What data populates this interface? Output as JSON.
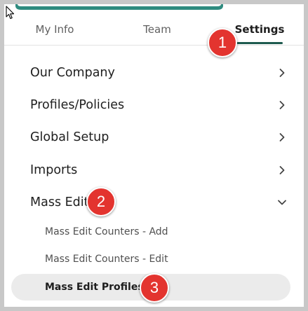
{
  "tabs": [
    {
      "label": "My Info",
      "active": false
    },
    {
      "label": "Team",
      "active": false
    },
    {
      "label": "Settings",
      "active": true
    }
  ],
  "menu": [
    {
      "label": "Our Company",
      "chevron": "chevron-right"
    },
    {
      "label": "Profiles/Policies",
      "chevron": "chevron-right"
    },
    {
      "label": "Global Setup",
      "chevron": "chevron-right"
    },
    {
      "label": "Imports",
      "chevron": "chevron-right"
    },
    {
      "label": "Mass Edit",
      "chevron": "chevron-down"
    }
  ],
  "submenu": [
    {
      "label": "Mass Edit Counters - Add",
      "selected": false
    },
    {
      "label": "Mass Edit Counters - Edit",
      "selected": false
    },
    {
      "label": "Mass Edit Profiles",
      "selected": true
    }
  ],
  "steps": [
    "1",
    "2",
    "3"
  ],
  "colors": {
    "accent": "#1e5a4f",
    "badge": "#e3342f",
    "selected_bg": "#ebebeb"
  }
}
